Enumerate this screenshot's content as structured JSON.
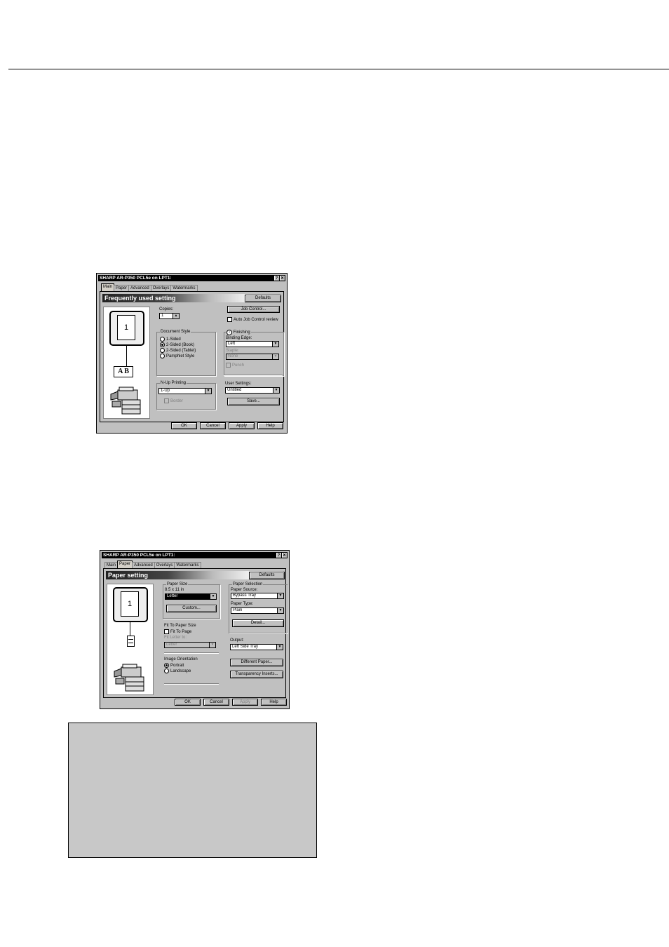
{
  "dialog1": {
    "title": "SHARP AR-P350 PCL5e on LPT1:",
    "help_btn": "?",
    "close_btn": "✕",
    "tabs": [
      "Main",
      "Paper",
      "Advanced",
      "Overlays",
      "Watermarks"
    ],
    "banner": "Frequently used setting",
    "defaults": "Defaults",
    "preview_page": "1",
    "preview_letters": "A B",
    "copies_label": "Copies:",
    "copies_value": "1",
    "job_control": "Job Control...",
    "auto_job_control": "Auto Job Control review",
    "document_style": {
      "title": "Document Style",
      "options": [
        "1-Sided",
        "2-Sided (Book)",
        "2-Sided (Tablet)",
        "Pamphlet Style"
      ]
    },
    "finishing": {
      "title": "Finishing",
      "binding_edge_label": "Binding Edge:",
      "binding_edge_value": "Left",
      "staple_label": "Staple:",
      "staple_value": "None",
      "punch_label": "Punch"
    },
    "nup": {
      "title": "N-Up Printing",
      "value": "1-Up",
      "border_label": "Border"
    },
    "user_settings": {
      "title": "User Settings:",
      "value": "Untitled",
      "save": "Save..."
    },
    "buttons": [
      "OK",
      "Cancel",
      "Apply",
      "Help"
    ]
  },
  "dialog2": {
    "title": "SHARP AR-P350 PCL5e on LPT1:",
    "help_btn": "?",
    "close_btn": "✕",
    "tabs": [
      "Main",
      "Paper",
      "Advanced",
      "Overlays",
      "Watermarks"
    ],
    "banner": "Paper setting",
    "defaults": "Defaults",
    "preview_page": "1",
    "paper_size": {
      "title": "Paper Size",
      "dims": "8.5 x 11 in",
      "value": "Letter",
      "custom": "Custom..."
    },
    "fit": {
      "title": "Fit To Paper Size",
      "fit_to_page": "Fit To Page",
      "fit_label": "Fit Letter to:",
      "fit_value": "Letter"
    },
    "orientation": {
      "title": "Image Orientation",
      "options": [
        "Portrait",
        "Landscape"
      ]
    },
    "paper_selection": {
      "title": "Paper Selection",
      "source_label": "Paper Source:",
      "source_value": "Bypass Tray",
      "type_label": "Paper Type:",
      "type_value": "Plain",
      "detail": "Detail..."
    },
    "output_label": "Output:",
    "output_value": "Left Side Tray",
    "different_paper": "Different Paper...",
    "transparency": "Transparency Inserts...",
    "buttons": [
      "OK",
      "Cancel",
      "Apply",
      "Help"
    ]
  }
}
